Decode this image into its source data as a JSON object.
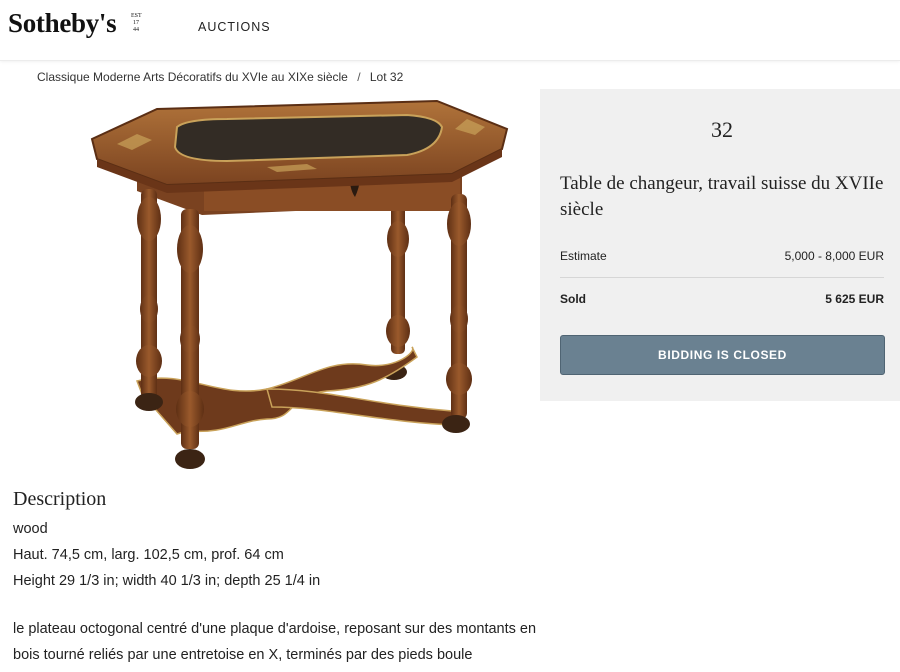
{
  "header": {
    "logo": "Sotheby's",
    "logo_est": "EST. 1744",
    "nav_auctions": "AUCTIONS"
  },
  "breadcrumb": {
    "items": [
      "Classique",
      "Moderne Arts Décoratifs du XVIe au XIXe siècle",
      "Lot 32"
    ],
    "separator": "/"
  },
  "lot": {
    "number": "32",
    "title": "Table de changeur, travail suisse du XVIIe siècle",
    "estimate_label": "Estimate",
    "estimate_value": "5,000 - 8,000 EUR",
    "sold_label": "Sold",
    "sold_value": "5 625 EUR",
    "bidding_button": "BIDDING IS CLOSED",
    "image_subject": "octagonal-top-walnut-table"
  },
  "description": {
    "heading": "Description",
    "lines": [
      "wood",
      "Haut. 74,5 cm, larg. 102,5 cm, prof. 64 cm",
      "Height 29 1/3 in; width 40 1/3 in; depth 25 1/4 in",
      "le plateau octogonal centré d'une plaque d'ardoise, reposant sur des montants en",
      "bois tourné reliés par une entretoise en X, terminés par des pieds boule"
    ]
  },
  "colors": {
    "panel_bg": "#f0f0f0",
    "button_bg": "#6a8191",
    "wood": "#7a4220",
    "slate": "#2f2b26"
  }
}
